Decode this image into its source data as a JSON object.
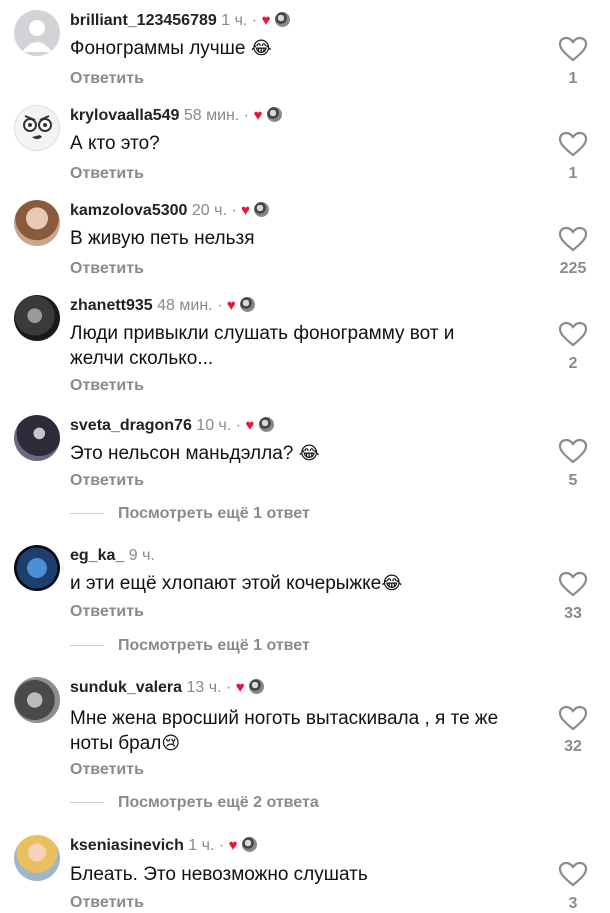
{
  "reply_label": "Ответить",
  "separator": " · ",
  "comments": [
    {
      "username": "brilliant_123456789",
      "time": "1 ч.",
      "text": "Фонограммы лучше",
      "emoji": "😂",
      "likes": "1",
      "liked_by_author": true
    },
    {
      "username": "krylovaalla549",
      "time": "58 мин.",
      "text": "А кто это?",
      "likes": "1",
      "liked_by_author": true
    },
    {
      "username": "kamzolova5300",
      "time": "20 ч.",
      "text": "В живую петь нельзя",
      "likes": "225",
      "liked_by_author": true
    },
    {
      "username": "zhanett935",
      "time": "48 мин.",
      "text_line1": "Люди привыкли слушать фонограмму вот и",
      "text_line2": "желчи сколько...",
      "likes": "2",
      "liked_by_author": true
    },
    {
      "username": "sveta_dragon76",
      "time": "10 ч.",
      "text": "Это нельсон маньдэлла?",
      "emoji": "😂",
      "likes": "5",
      "liked_by_author": true,
      "more_replies": "Посмотреть ещё 1 ответ"
    },
    {
      "username": "eg_ka_",
      "time": "9 ч.",
      "text": "и эти ещё хлопают этой кочерыжке",
      "emoji": "😂",
      "likes": "33",
      "liked_by_author": false,
      "more_replies": "Посмотреть ещё 1 ответ"
    },
    {
      "username": "sunduk_valera",
      "time": "13 ч.",
      "text_line1": "Мне жена вросший ноготь вытаскивала , я те же",
      "text_line2": "ноты брал",
      "emoji": "😢",
      "likes": "32",
      "liked_by_author": true,
      "more_replies": "Посмотреть ещё 2 ответа"
    },
    {
      "username": "kseniasinevich",
      "time": "1 ч.",
      "text": "Блеать. Это невозможно слушать",
      "likes": "3",
      "liked_by_author": true
    }
  ],
  "icons": {
    "like": "heart-outline-icon",
    "author_like": "red-heart-icon",
    "author_avatar": "creator-avatar-icon"
  },
  "colors": {
    "secondary_text": "#8a8a8a",
    "heart": "#e8143a"
  }
}
